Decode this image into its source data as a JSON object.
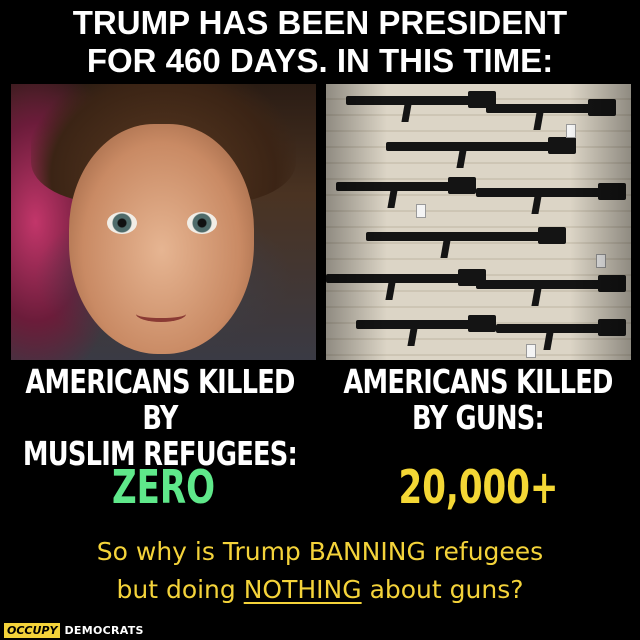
{
  "headline": {
    "line1": "TRUMP HAS BEEN PRESIDENT",
    "line2": "FOR 460 DAYS. IN THIS TIME:"
  },
  "left_panel": {
    "caption_line1": "AMERICANS KILLED BY",
    "caption_line2": "MUSLIM REFUGEES:",
    "figure": "ZERO",
    "figure_color": "#5fe88a"
  },
  "right_panel": {
    "caption_line1": "AMERICANS KILLED",
    "caption_line2": "BY GUNS:",
    "figure": "20,000+",
    "figure_color": "#f4d735"
  },
  "question": {
    "line1": "So why is Trump BANNING refugees",
    "line2_before": "but doing ",
    "line2_emphasis": "NOTHING",
    "line2_after": " about guns?",
    "color": "#f4d33a"
  },
  "branding": {
    "box_text": "OCCUPY",
    "text": "DEMOCRATS"
  }
}
